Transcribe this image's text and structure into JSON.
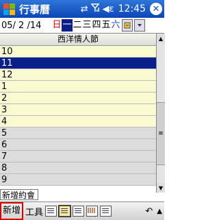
{
  "titlebar": {
    "app_title": "行事曆",
    "clock": "12:45",
    "icons": [
      "windows-start-icon",
      "sync-icon",
      "signal-icon",
      "volume-icon",
      "close-icon"
    ],
    "close_label": "✕"
  },
  "datebar": {
    "date": "05/ 2 /14",
    "weekdays": [
      {
        "label": "日",
        "day": "sunday"
      },
      {
        "label": "一",
        "day": "monday",
        "selected": true
      },
      {
        "label": "二",
        "day": "tuesday"
      },
      {
        "label": "三",
        "day": "wednesday"
      },
      {
        "label": "四",
        "day": "thursday"
      },
      {
        "label": "五",
        "day": "friday"
      },
      {
        "label": "六",
        "day": "saturday"
      }
    ]
  },
  "holiday_banner": "西洋情人節",
  "hours": [
    {
      "label": "10",
      "state": "work"
    },
    {
      "label": "11",
      "state": "selected"
    },
    {
      "label": "12",
      "state": "work"
    },
    {
      "label": "1",
      "state": "work"
    },
    {
      "label": "2",
      "state": "work"
    },
    {
      "label": "3",
      "state": "work"
    },
    {
      "label": "4",
      "state": "work"
    },
    {
      "label": "5",
      "state": "off"
    },
    {
      "label": "6",
      "state": "off"
    },
    {
      "label": "7",
      "state": "off"
    },
    {
      "label": "8",
      "state": "off"
    },
    {
      "label": "9",
      "state": "off"
    }
  ],
  "new_appointment_tab": "新增約會",
  "menubar": {
    "new_label": "新增",
    "tools_label": "工具",
    "views": [
      "agenda-view",
      "day-view",
      "week-view",
      "month-view",
      "year-view"
    ],
    "active_view": "day-view"
  },
  "colors": {
    "titlebar": "#0b46b8",
    "selection": "#0b1f8a",
    "work_hours": "#fafad2",
    "off_hours": "#dcdcdc",
    "sunday": "#d00000",
    "saturday": "#2040d0",
    "new_button_highlight": "#e00000"
  }
}
